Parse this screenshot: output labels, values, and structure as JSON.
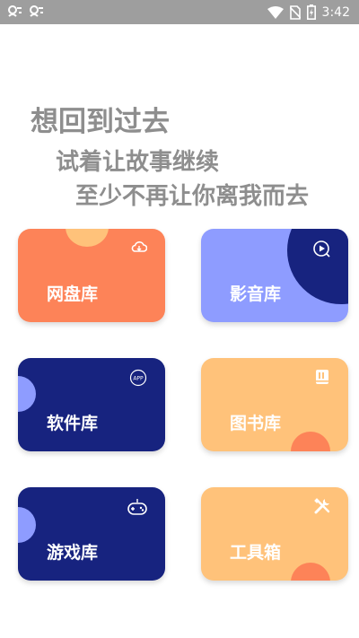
{
  "status_bar": {
    "left_icons": [
      "app-notification-icon",
      "app-notification-icon"
    ],
    "time": "3:42",
    "icons": [
      "wifi-icon",
      "no-sim-icon",
      "battery-charging-icon"
    ]
  },
  "poem": {
    "line1": "想回到过去",
    "line2": "试着让故事继续",
    "line3": "至少不再让你离我而去"
  },
  "cards": [
    {
      "label": "网盘库",
      "icon": "cloud-icon",
      "bg": "#fd8358",
      "accent": "#ffc27a"
    },
    {
      "label": "影音库",
      "icon": "play-icon",
      "bg": "#8e9cff",
      "accent": "#17237f"
    },
    {
      "label": "软件库",
      "icon": "app-icon",
      "icon_text": "APP",
      "bg": "#17237f",
      "accent": "#8e9cff"
    },
    {
      "label": "图书库",
      "icon": "book-icon",
      "bg": "#ffc27a",
      "accent": "#fd8358"
    },
    {
      "label": "游戏库",
      "icon": "gamepad-icon",
      "bg": "#17237f",
      "accent": "#8e9cff"
    },
    {
      "label": "工具箱",
      "icon": "tools-icon",
      "bg": "#ffc27a",
      "accent": "#fd8358"
    }
  ]
}
